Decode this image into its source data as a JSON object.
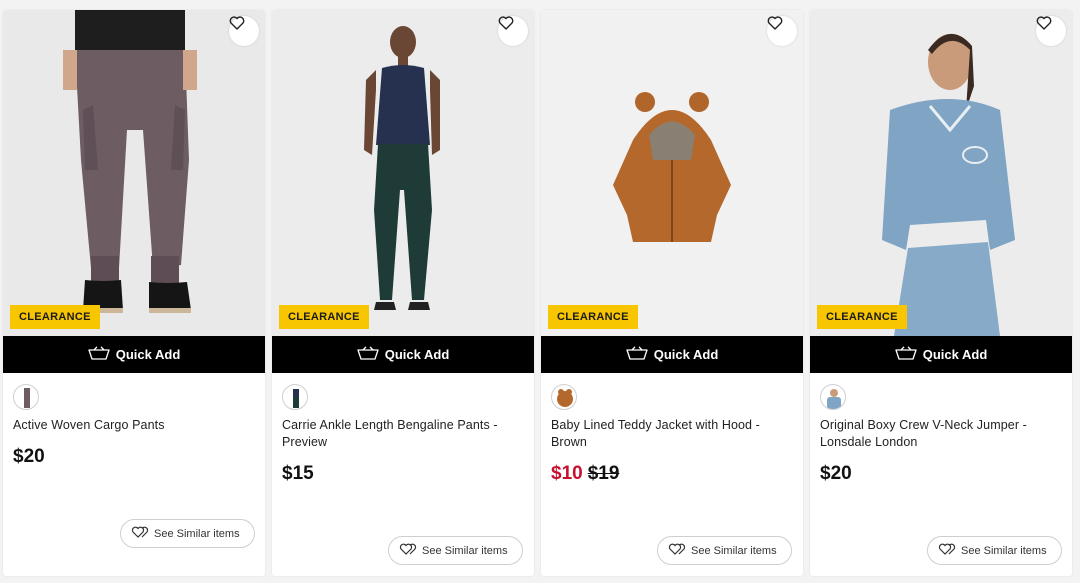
{
  "quick_add_label": "Quick Add",
  "similar_label": "See Similar items",
  "badge_label": "CLEARANCE",
  "products": [
    {
      "name": "Active Woven Cargo Pants",
      "price": "$20",
      "sale_price": "",
      "original_price": ""
    },
    {
      "name": "Carrie Ankle Length Bengaline Pants - Preview",
      "price": "$15",
      "sale_price": "",
      "original_price": ""
    },
    {
      "name": "Baby Lined Teddy Jacket with Hood - Brown",
      "price": "",
      "sale_price": "$10",
      "original_price": "$19"
    },
    {
      "name": "Original Boxy Crew V-Neck Jumper - Lonsdale London",
      "price": "$20",
      "sale_price": "",
      "original_price": ""
    }
  ],
  "colors": {
    "badge": "#f7c600",
    "sale": "#c8102e",
    "quick_add_bg": "#000000"
  },
  "icons": {
    "wishlist": "heart-icon",
    "quick_add": "basket-icon",
    "similar": "hearts-icon"
  }
}
